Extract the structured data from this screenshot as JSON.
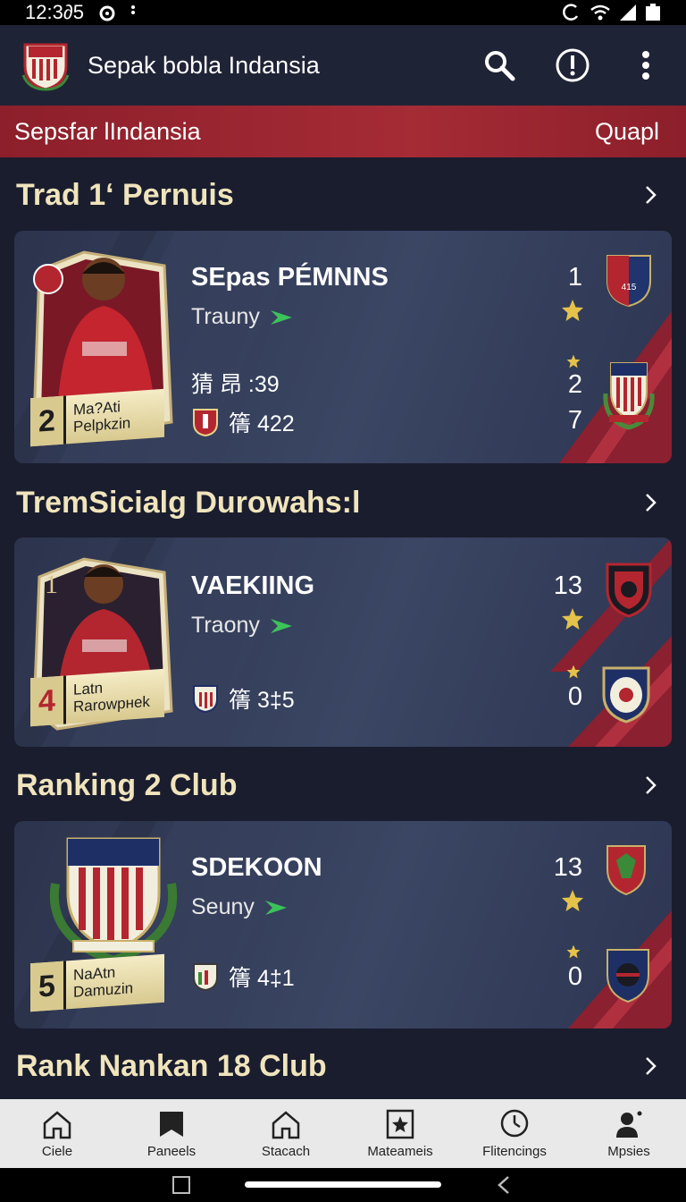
{
  "status_bar": {
    "time": "12:3∂5"
  },
  "app_bar": {
    "title": "Sepak bobla Indansia"
  },
  "banner": {
    "left": "Sepsfar lIndansia",
    "right": "Quapl"
  },
  "sections": [
    {
      "title": "Trad 1ʻ Pernuis"
    },
    {
      "title": "TremSicialg Durowahs:l"
    },
    {
      "title": "Ranking 2 Club"
    },
    {
      "title": "Rank Nankan 18 Club"
    }
  ],
  "cards": [
    {
      "rank": "2",
      "name_line1": "Ma?Ati",
      "name_line2": "Pelpkzin",
      "title": "SEpas PÉMNNS",
      "subtitle": "Trauny",
      "stat1": "猜 昂 :39",
      "stat2": "篟 422",
      "num_top": "1",
      "num_mid": "2",
      "num_bot": "7",
      "crest_text": "415"
    },
    {
      "rank": "4",
      "name_line1": "Latn",
      "name_line2": "Rarowpнеk",
      "title": "VAEKIING",
      "subtitle": "Traony",
      "stat1": "篟 3‡5",
      "num_top": "13",
      "num_bot": "0"
    },
    {
      "rank": "5",
      "name_line1": "NaAtn",
      "name_line2": "Damuzin",
      "title": "SDEKOON",
      "subtitle": "Seuny",
      "stat1": "篟 4‡1",
      "num_top": "13",
      "num_bot": "0"
    }
  ],
  "bottom_nav": [
    {
      "label": "Ciele",
      "icon": "home-icon"
    },
    {
      "label": "Paneels",
      "icon": "bookmark-icon"
    },
    {
      "label": "Stacach",
      "icon": "home-icon"
    },
    {
      "label": "Mateameis",
      "icon": "star-box-icon"
    },
    {
      "label": "Flitencings",
      "icon": "clock-icon"
    },
    {
      "label": "Mpsies",
      "icon": "profile-icon"
    }
  ],
  "colors": {
    "accent_red": "#a52b35",
    "section_title": "#f0e4bc",
    "card_bg": "#3a4663",
    "arrow_green": "#3bc35a",
    "star_gold": "#e5c24a"
  }
}
